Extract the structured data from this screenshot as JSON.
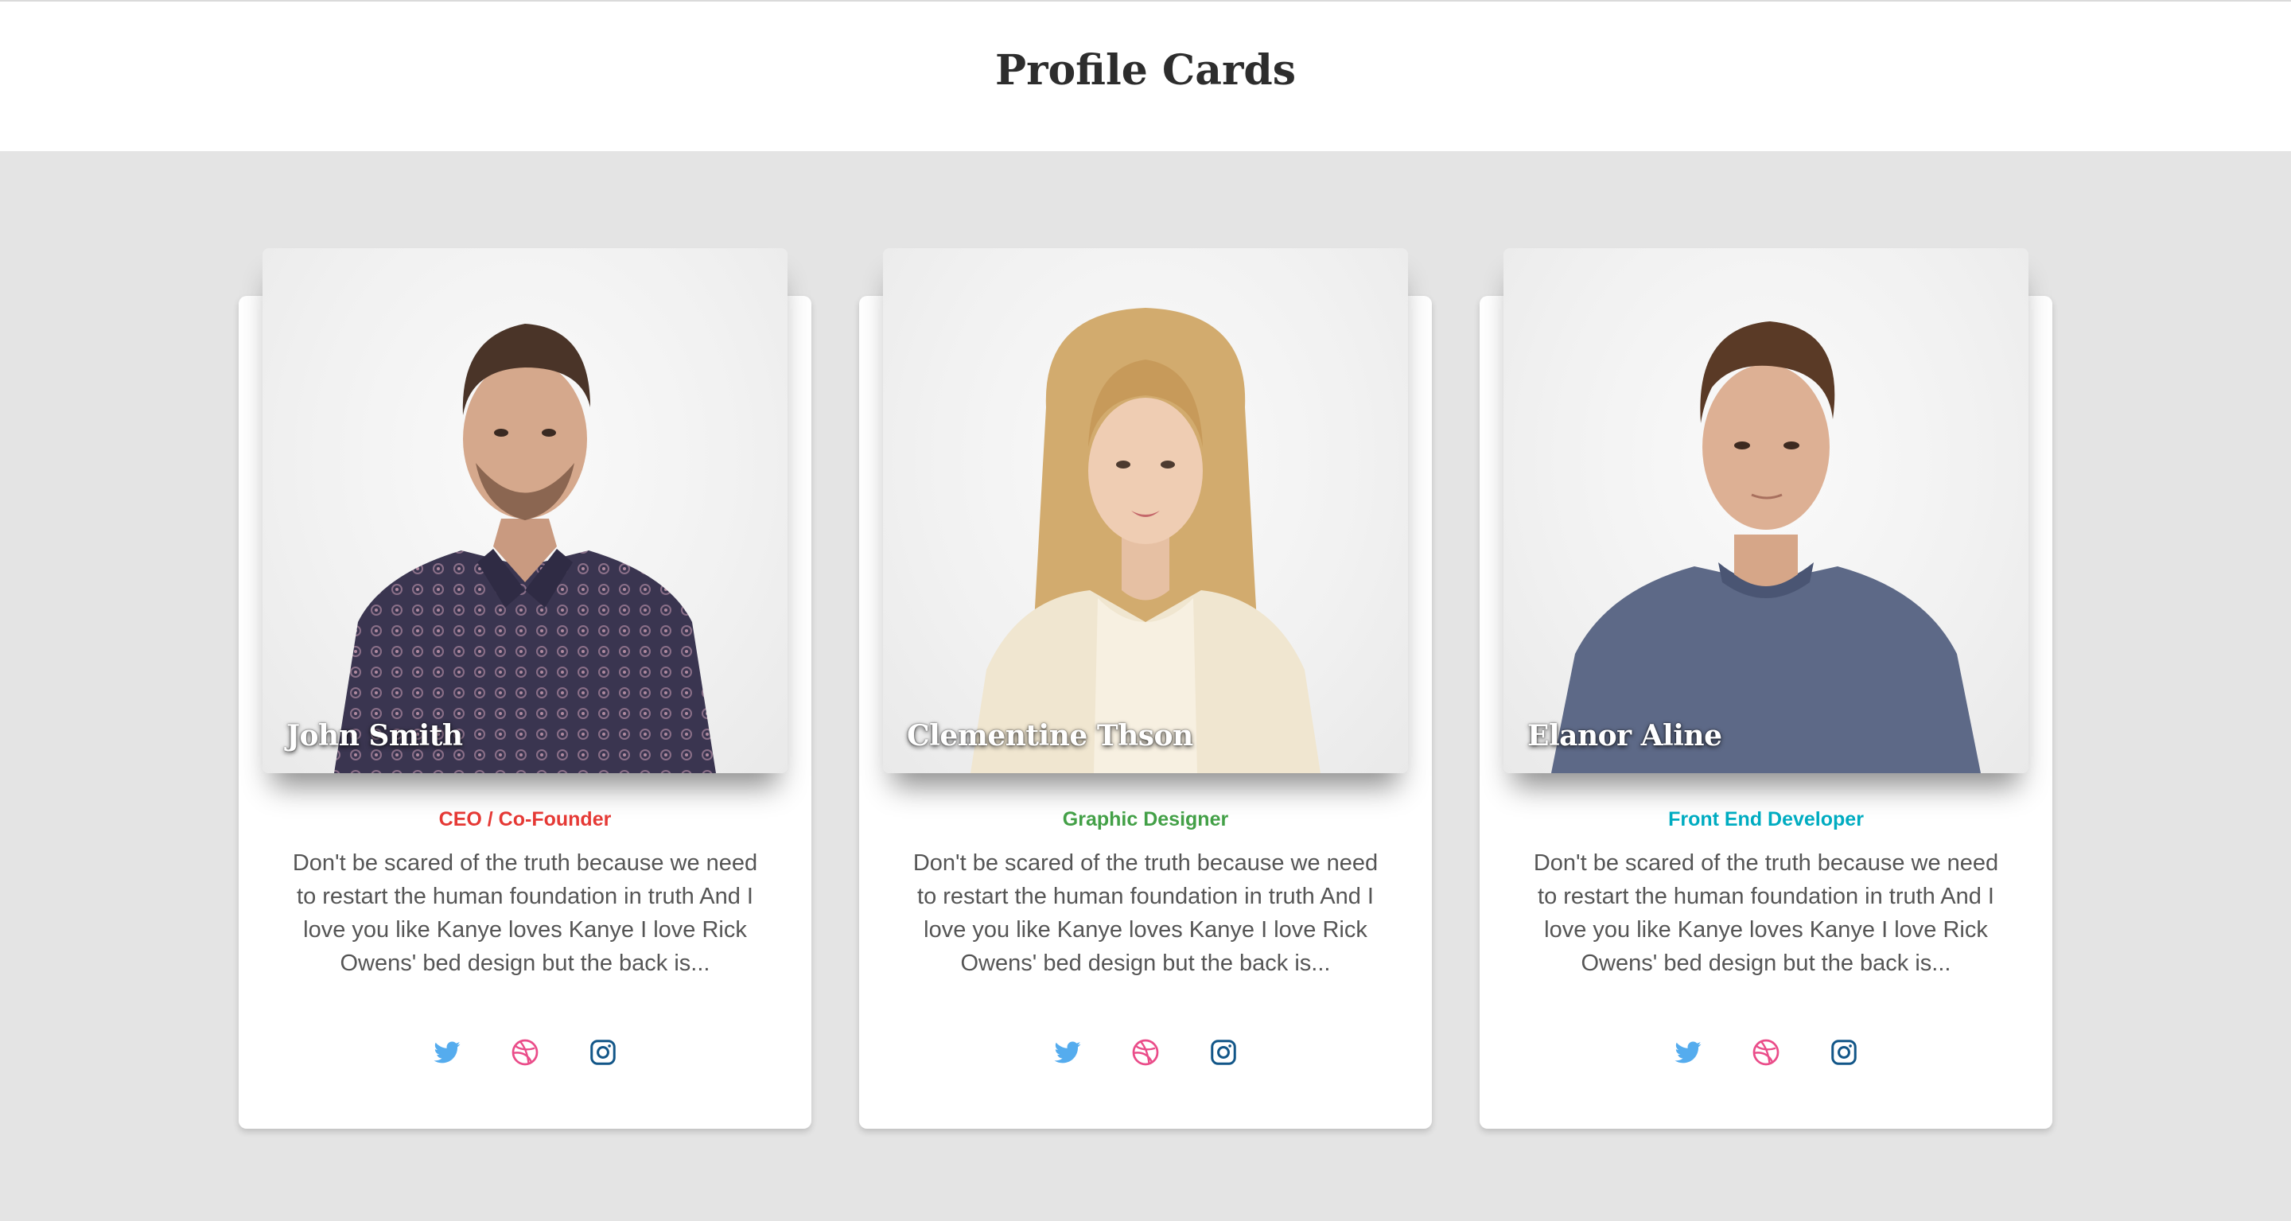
{
  "page": {
    "title": "Profile Cards"
  },
  "colors": {
    "twitter": "#55acee",
    "dribbble": "#ea4c89",
    "instagram": "#125688"
  },
  "cards": [
    {
      "name": "John Smith",
      "role": "CEO / Co-Founder",
      "role_color": "#e53935",
      "bio": "Don't be scared of the truth because we need to restart the human foundation in truth And I love you like Kanye loves Kanye I love Rick Owens' bed design but the back is...",
      "socials": [
        "twitter-icon",
        "dribbble-icon",
        "instagram-icon"
      ]
    },
    {
      "name": "Clementine Thson",
      "role": "Graphic Designer",
      "role_color": "#43a047",
      "bio": "Don't be scared of the truth because we need to restart the human foundation in truth And I love you like Kanye loves Kanye I love Rick Owens' bed design but the back is...",
      "socials": [
        "twitter-icon",
        "dribbble-icon",
        "instagram-icon"
      ]
    },
    {
      "name": "Elanor Aline",
      "role": "Front End Developer",
      "role_color": "#00acc1",
      "bio": "Don't be scared of the truth because we need to restart the human foundation in truth And I love you like Kanye loves Kanye I love Rick Owens' bed design but the back is...",
      "socials": [
        "twitter-icon",
        "dribbble-icon",
        "instagram-icon"
      ]
    }
  ]
}
